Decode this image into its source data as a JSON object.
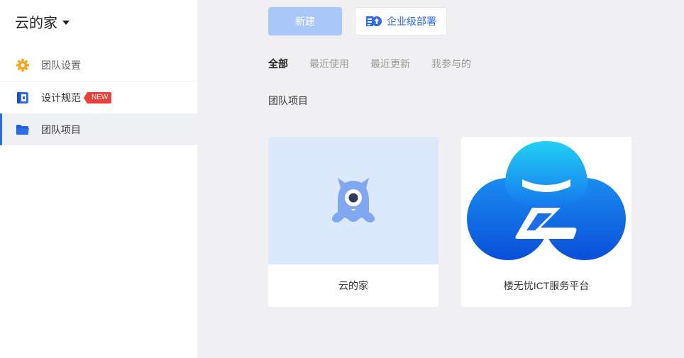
{
  "sidebar": {
    "team_name": "云的家",
    "items": [
      {
        "label": "团队设置",
        "icon": "gear-icon"
      },
      {
        "label": "设计规范",
        "icon": "design-spec-icon",
        "badge": "NEW"
      },
      {
        "label": "团队项目",
        "icon": "folder-icon"
      }
    ]
  },
  "toolbar": {
    "new_label": "新建",
    "deploy_label": "企业级部署"
  },
  "tabs": [
    "全部",
    "最近使用",
    "最近更新",
    "我参与的"
  ],
  "section_title": "团队项目",
  "projects": [
    {
      "name": "云的家",
      "icon": "monster-mascot-icon"
    },
    {
      "name": "楼无忧ICT服务平台",
      "icon": "cloud-logo-icon"
    }
  ],
  "colors": {
    "accent": "#2e6be6",
    "badge": "#e8413c",
    "gear": "#f5a623",
    "new_button": "#a9c8f8"
  }
}
